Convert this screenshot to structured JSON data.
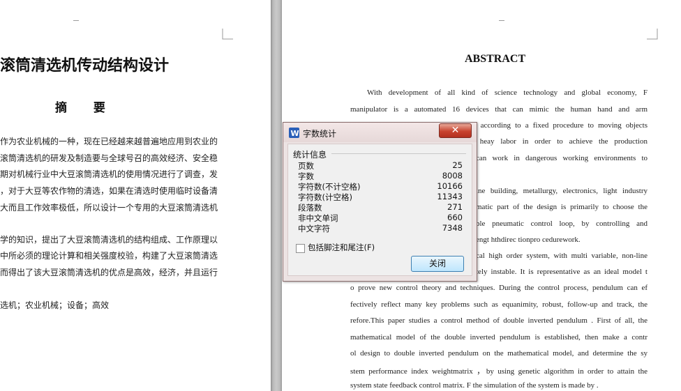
{
  "left_page": {
    "title": "滚筒清选机传动结构设计",
    "abstract_heading": "摘  要",
    "paragraph1": [
      "作为农业机械的一种，现在已经越来越普遍地应用到农业的",
      "滚筒清选机的研发及制造要与全球号召的高效经济、安全稳",
      "期对机械行业中大豆滚筒清选机的使用情况进行了调查，发",
      "，对于大豆等农作物的清选，如果在清选时使用临时设备清",
      "大而且工作效率极低，所以设计一个专用的大豆滚筒清选机"
    ],
    "paragraph2": [
      "学的知识，提出了大豆滚筒清选机的结构组成、工作原理以",
      "中所必须的理论计算和相关强度校验，构建了大豆滚筒清选",
      "而得出了该大豆滚筒清选机的优点是高效，经济，并且运行"
    ],
    "keywords": "选机；农业机械；设备；高效"
  },
  "right_page": {
    "heading": "ABSTRACT",
    "lines_top": [
      "With development of all kind of science technology and global economy, F",
      "manipulator is a automated 16 devices that can mimic the human hand and arm",
      "m according to a fixed procedure to moving objects",
      "e heay labor in order to achieve the production",
      "can work in dangerous working environments to"
    ],
    "lines_mid": [
      "ine building, metallurgy, electronics, light industry",
      "matic part of the design is primarily to choose the",
      "ble pneumatic control loop, by controlling and",
      "engt   hthdirec tionpro cedurework."
    ],
    "lines_bottom": [
      "cal high order system, with multi variable, non-line",
      "tely instable. It is representative as an ideal model t",
      "o prove new control theory and techniques. During the control process, pendulum can ef",
      "fectively reflect many key problems such as equanimity, robust, follow-up and track, the",
      "refore.This paper studies a control method of double inverted pendulum . First of all, the",
      " mathematical model of the double inverted pendulum is established, then make a contr",
      "ol design to double inverted pendulum on the mathematical model, and determine the sy",
      "stem performance index weightmatrix ，by using genetic algorithm in order to attain the",
      " system state feedback control matrix. F the simulation of the system is made by ."
    ]
  },
  "dialog": {
    "title": "字数统计",
    "close_glyph": "✕",
    "group_label": "统计信息",
    "stats": [
      {
        "label": "页数",
        "value": "25"
      },
      {
        "label": "字数",
        "value": "8008"
      },
      {
        "label": "字符数(不计空格)",
        "value": "10166"
      },
      {
        "label": "字符数(计空格)",
        "value": "11343"
      },
      {
        "label": "段落数",
        "value": "271"
      },
      {
        "label": "非中文单词",
        "value": "660"
      },
      {
        "label": "中文字符",
        "value": "7348"
      }
    ],
    "checkbox_label": "包括脚注和尾注(F)",
    "checkbox_checked": false,
    "close_button": "关闭"
  },
  "colors": {
    "app_icon": "#2a5fb8",
    "close_red": "#c8432f",
    "button_blue": "#bee6fd"
  },
  "icons": {
    "app": "wps-writer-icon",
    "close": "close-icon"
  }
}
